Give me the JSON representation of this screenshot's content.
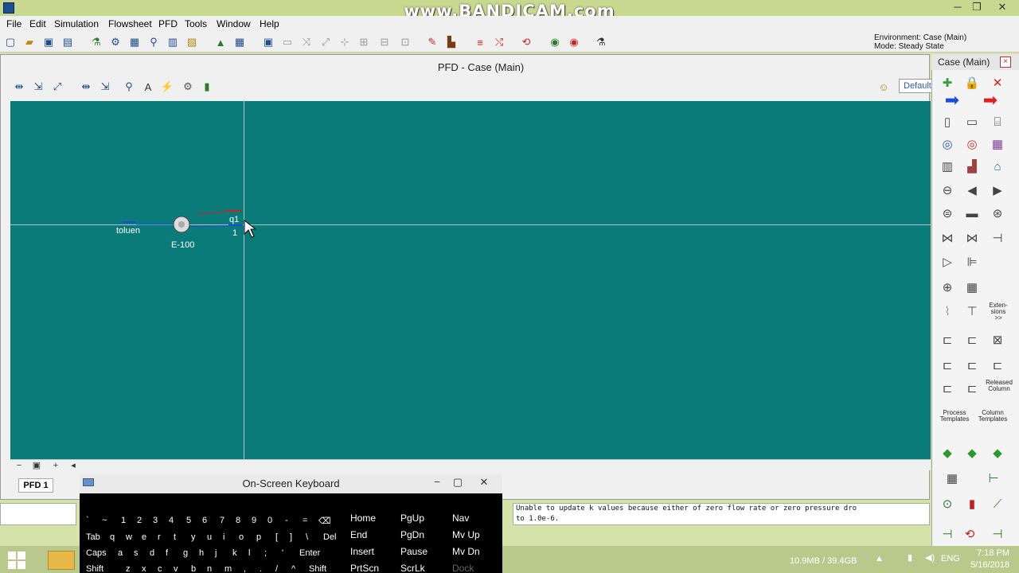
{
  "window": {
    "watermark": "www.BANDICAM.com",
    "minimize": "─",
    "restore": "❐",
    "close": "✕"
  },
  "menu": [
    "File",
    "Edit",
    "Simulation",
    "Flowsheet",
    "PFD",
    "Tools",
    "Window",
    "Help"
  ],
  "environment": {
    "line1": "Environment: Case (Main)",
    "line2": "Mode: Steady State"
  },
  "pfd": {
    "title": "PFD - Case (Main)",
    "default_label": "Default",
    "tab": "PFD 1",
    "stream_in_label": "toluen",
    "unit_label": "E-100",
    "stream_q_label": "q1",
    "stream_out_label": "1"
  },
  "palette": {
    "title": "Case (Main)",
    "close": "×",
    "extensions": "Exten-\nsions\n>>",
    "released_column": "Released\nColumn",
    "process_templates": "Process\nTemplates",
    "column_templates": "Column\nTemplates"
  },
  "keyboard": {
    "title": "On-Screen Keyboard",
    "row1": [
      "`",
      "~",
      "1",
      "2",
      "3",
      "4",
      "5",
      "6",
      "7",
      "8",
      "9",
      "0",
      "-",
      "=",
      "⌫"
    ],
    "row2": [
      "Tab",
      "q",
      "w",
      "e",
      "r",
      "t",
      "y",
      "u",
      "i",
      "o",
      "p",
      "[",
      "]",
      "\\",
      "Del"
    ],
    "row3": [
      "Caps",
      "a",
      "s",
      "d",
      "f",
      "g",
      "h",
      "j",
      "k",
      "l",
      ";",
      "'",
      "Enter"
    ],
    "row4": [
      "Shift",
      "z",
      "x",
      "c",
      "v",
      "b",
      "n",
      "m",
      ",",
      ".",
      "/",
      "^",
      "Shift"
    ],
    "nav": [
      [
        "Home",
        "PgUp",
        "Nav"
      ],
      [
        "End",
        "PgDn",
        "Mv Up"
      ],
      [
        "Insert",
        "Pause",
        "Mv Dn"
      ],
      [
        "PrtScn",
        "ScrLk",
        "Dock"
      ]
    ]
  },
  "message": {
    "line1": "Unable to update k values because either of zero flow rate or zero pressure dro",
    "line2": "to 1.0e-6."
  },
  "taskbar": {
    "memory": "10.9MB / 39.4GB",
    "lang": "ENG",
    "time": "7:18 PM",
    "date": "5/16/2018"
  }
}
